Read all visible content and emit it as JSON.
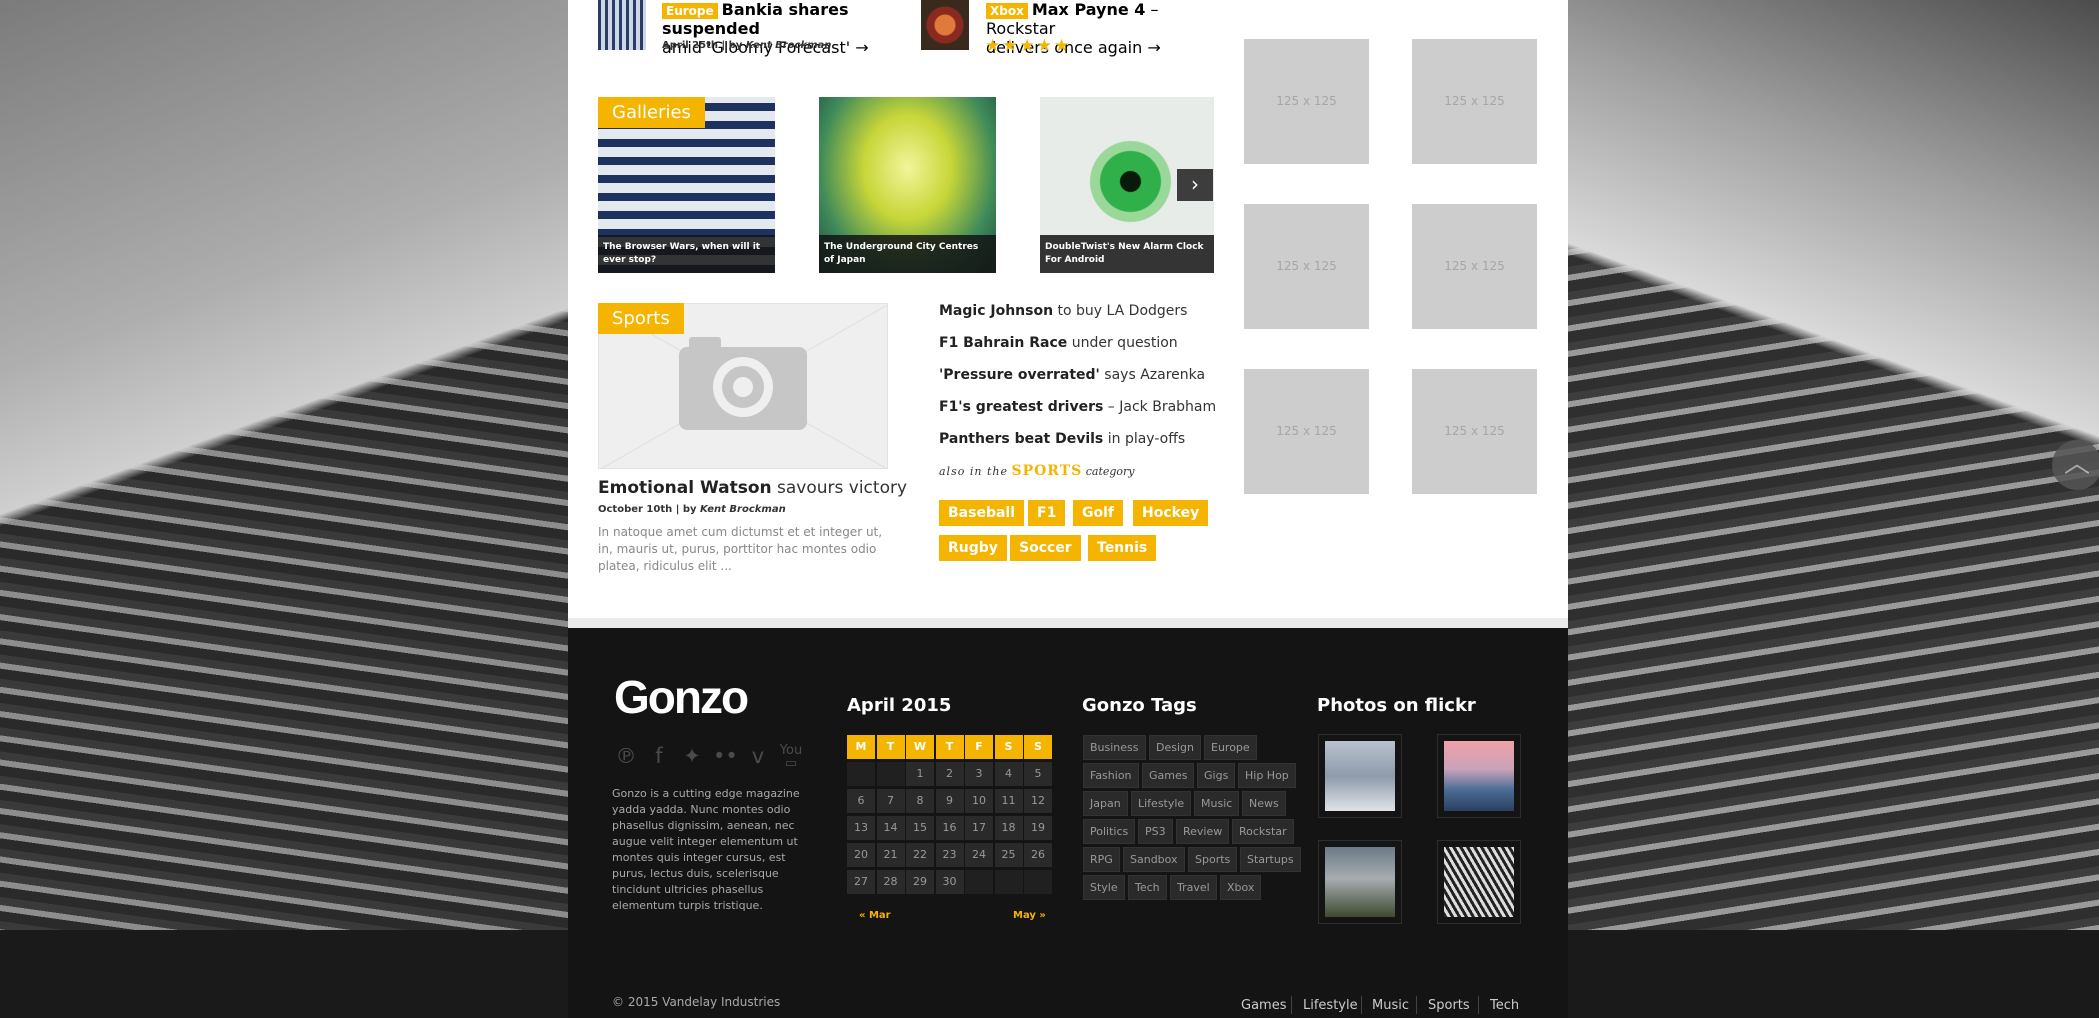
{
  "news": [
    {
      "tag": "Europe",
      "title_bold": "Bankia shares suspended",
      "title_rest": "amid 'Gloomy Forecast'",
      "arrow": "→",
      "date": "April 25th | by",
      "author": "Kent Brockman"
    },
    {
      "tag": "Xbox",
      "title_bold": "Max Payne 4",
      "title_rest": "– Rockstar",
      "line2": "delivers once again",
      "arrow": "→",
      "stars": "★★★★★",
      "rating": 4.5
    }
  ],
  "ads": {
    "label": "125 x 125"
  },
  "galleries": {
    "label": "Galleries",
    "items": [
      {
        "caption": "The Browser Wars, when will it ever stop?"
      },
      {
        "caption": "The Underground City Centres of Japan"
      },
      {
        "caption": "DoubleTwist's New Alarm Clock For Android"
      }
    ],
    "next_icon": "›"
  },
  "sports": {
    "label": "Sports",
    "headline_bold": "Emotional Watson",
    "headline_rest": "savours victory",
    "date": "October 10th | by",
    "author": "Kent Brockman",
    "excerpt": "In natoque amet cum dictumst et et integer ut, in, mauris ut, purus, porttitor hac montes odio platea, ridiculus elit ...",
    "list": [
      {
        "bold": "Magic Johnson",
        "rest": "to buy LA Dodgers"
      },
      {
        "bold": "F1 Bahrain Race",
        "rest": "under question"
      },
      {
        "bold": "'Pressure overrated'",
        "rest": "says Azarenka"
      },
      {
        "bold": "F1's greatest drivers",
        "rest": "– Jack Brabham"
      },
      {
        "bold": "Panthers beat Devils",
        "rest": "in play-offs"
      }
    ],
    "also_pre": "also in the",
    "also_cat": "SPORTS",
    "also_post": "category",
    "tags": [
      "Baseball",
      "F1",
      "Golf",
      "Hockey",
      "Rugby",
      "Soccer",
      "Tennis"
    ]
  },
  "footer": {
    "logo": "Gonzo",
    "about": "Gonzo is a cutting edge magazine yadda yadda. Nunc montes odio phasellus dignissim, aenean, nec augue velit integer elementum ut montes quis integer cursus, est purus, lectus duis, scelerisque tincidunt ultricies phasellus elementum turpis tristique.",
    "calendar": {
      "title": "April 2015",
      "days": [
        "M",
        "T",
        "W",
        "T",
        "F",
        "S",
        "S"
      ],
      "prev": "« Mar",
      "next": "May »"
    },
    "tags_title": "Gonzo Tags",
    "tags": [
      "Business",
      "Design",
      "Europe",
      "Fashion",
      "Games",
      "Gigs",
      "Hip Hop",
      "Japan",
      "Lifestyle",
      "Music",
      "News",
      "Politics",
      "PS3",
      "Review",
      "Rockstar",
      "RPG",
      "Sandbox",
      "Sports",
      "Startups",
      "Style",
      "Tech",
      "Travel",
      "Xbox"
    ],
    "flickr_title": "Photos on flickr",
    "copyright": "© 2015 Vandelay Industries",
    "nav": [
      "Games",
      "Lifestyle",
      "Music",
      "Sports",
      "Tech"
    ]
  },
  "colors": {
    "accent": "#f5b400",
    "footer_bg": "#141414"
  }
}
